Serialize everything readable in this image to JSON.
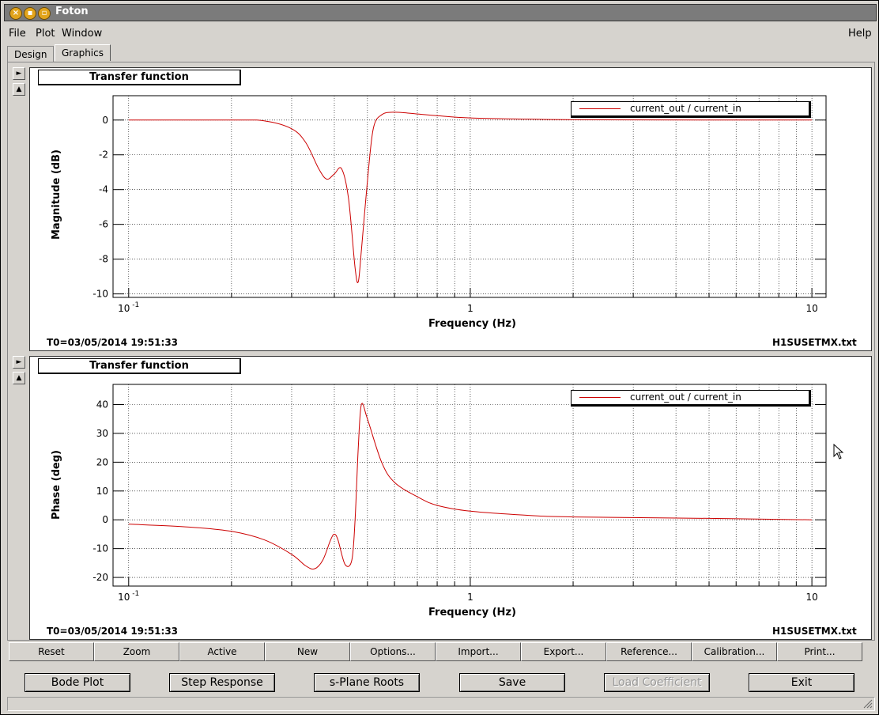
{
  "window": {
    "title": "Foton"
  },
  "menubar": {
    "file": "File",
    "plot": "Plot",
    "window": "Window",
    "help": "Help"
  },
  "tabs": [
    {
      "label": "Design"
    },
    {
      "label": "Graphics"
    }
  ],
  "plots": [
    {
      "title": "Transfer function",
      "ylabel": "Magnitude (dB)",
      "xlabel": "Frequency (Hz)",
      "t0": "T0=03/05/2014 19:51:33",
      "file": "H1SUSETMX.txt",
      "legend": "current_out / current_in",
      "yticks": [
        "0",
        "-2",
        "-4",
        "-6",
        "-8",
        "-10"
      ],
      "xticks": [
        "10",
        "-1",
        "1",
        "10"
      ]
    },
    {
      "title": "Transfer function",
      "ylabel": "Phase (deg)",
      "xlabel": "Frequency (Hz)",
      "t0": "T0=03/05/2014 19:51:33",
      "file": "H1SUSETMX.txt",
      "legend": "current_out / current_in",
      "yticks": [
        "40",
        "30",
        "20",
        "10",
        "0",
        "-10",
        "-20"
      ],
      "xticks": [
        "10",
        "-1",
        "1",
        "10"
      ]
    }
  ],
  "chart_data": [
    {
      "type": "line",
      "title": "Transfer function",
      "xlabel": "Frequency (Hz)",
      "ylabel": "Magnitude (dB)",
      "xscale": "log",
      "xlim": [
        0.09,
        11
      ],
      "ylim": [
        -10.2,
        1.4
      ],
      "grid": true,
      "legend_position": "top-right",
      "series": [
        {
          "name": "current_out / current_in",
          "color": "#cc0000",
          "x": [
            0.1,
            0.2,
            0.25,
            0.3,
            0.33,
            0.36,
            0.38,
            0.4,
            0.42,
            0.44,
            0.46,
            0.47,
            0.48,
            0.5,
            0.52,
            0.55,
            0.6,
            0.7,
            0.8,
            1,
            1.5,
            2,
            5,
            10
          ],
          "y": [
            0,
            0,
            -0.05,
            -0.5,
            -1.3,
            -2.8,
            -3.4,
            -3.1,
            -2.8,
            -4.5,
            -8.5,
            -9.3,
            -7.5,
            -3.5,
            -0.5,
            0.3,
            0.45,
            0.35,
            0.25,
            0.12,
            0.05,
            0.02,
            0,
            0
          ]
        }
      ]
    },
    {
      "type": "line",
      "title": "Transfer function",
      "xlabel": "Frequency (Hz)",
      "ylabel": "Phase (deg)",
      "xscale": "log",
      "xlim": [
        0.09,
        11
      ],
      "ylim": [
        -23,
        47
      ],
      "grid": true,
      "legend_position": "top-right",
      "series": [
        {
          "name": "current_out / current_in",
          "color": "#cc0000",
          "x": [
            0.1,
            0.15,
            0.2,
            0.25,
            0.3,
            0.33,
            0.35,
            0.37,
            0.39,
            0.4,
            0.41,
            0.43,
            0.45,
            0.46,
            0.47,
            0.48,
            0.5,
            0.55,
            0.6,
            0.7,
            0.8,
            1,
            1.5,
            2,
            5,
            10
          ],
          "y": [
            -1.5,
            -2.5,
            -4,
            -7,
            -12,
            -16,
            -17,
            -14,
            -7,
            -5,
            -7,
            -15.5,
            -14,
            0,
            25,
            40,
            35,
            20,
            13,
            8,
            5,
            3,
            1.5,
            1,
            0.5,
            0
          ]
        }
      ]
    }
  ],
  "toolbar": [
    "Reset",
    "Zoom",
    "Active",
    "New",
    "Options...",
    "Import...",
    "Export...",
    "Reference...",
    "Calibration...",
    "Print..."
  ],
  "bottom_buttons": {
    "bode": "Bode Plot",
    "step": "Step Response",
    "splane": "s-Plane Roots",
    "save": "Save",
    "load": "Load Coefficient",
    "exit": "Exit"
  }
}
